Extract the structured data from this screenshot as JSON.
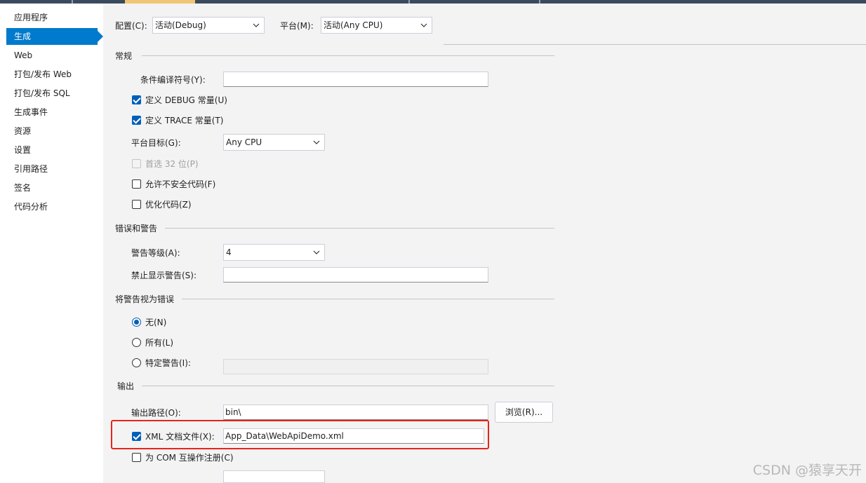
{
  "sidebar": {
    "items": [
      {
        "label": "应用程序",
        "active": false
      },
      {
        "label": "生成",
        "active": true
      },
      {
        "label": "Web",
        "active": false
      },
      {
        "label": "打包/发布 Web",
        "active": false
      },
      {
        "label": "打包/发布 SQL",
        "active": false
      },
      {
        "label": "生成事件",
        "active": false
      },
      {
        "label": "资源",
        "active": false
      },
      {
        "label": "设置",
        "active": false
      },
      {
        "label": "引用路径",
        "active": false
      },
      {
        "label": "签名",
        "active": false
      },
      {
        "label": "代码分析",
        "active": false
      }
    ]
  },
  "header": {
    "config_label": "配置(C):",
    "config_value": "活动(Debug)",
    "platform_label": "平台(M):",
    "platform_value": "活动(Any CPU)"
  },
  "general": {
    "title": "常规",
    "conditional_symbols_label": "条件编译符号(Y):",
    "conditional_symbols_value": "",
    "define_debug_label": "定义 DEBUG 常量(U)",
    "define_debug_checked": true,
    "define_trace_label": "定义 TRACE 常量(T)",
    "define_trace_checked": true,
    "platform_target_label": "平台目标(G):",
    "platform_target_value": "Any CPU",
    "prefer32_label": "首选 32 位(P)",
    "prefer32_checked": false,
    "allow_unsafe_label": "允许不安全代码(F)",
    "allow_unsafe_checked": false,
    "optimize_label": "优化代码(Z)",
    "optimize_checked": false
  },
  "errors": {
    "title": "错误和警告",
    "warning_level_label": "警告等级(A):",
    "warning_level_value": "4",
    "suppress_warnings_label": "禁止显示警告(S):",
    "suppress_warnings_value": ""
  },
  "treat_warnings": {
    "title": "将警告视为错误",
    "none_label": "无(N)",
    "all_label": "所有(L)",
    "specific_label": "特定警告(I):",
    "selected": "none",
    "specific_value": ""
  },
  "output": {
    "title": "输出",
    "output_path_label": "输出路径(O):",
    "output_path_value": "bin\\",
    "browse_label": "浏览(R)...",
    "xml_doc_label": "XML 文档文件(X):",
    "xml_doc_checked": true,
    "xml_doc_value": "App_Data\\WebApiDemo.xml",
    "com_interop_label": "为 COM 互操作注册(C)",
    "com_interop_checked": false
  },
  "watermark": "CSDN @猿享天开",
  "colors": {
    "accent": "#007acc",
    "checkbox_blue": "#005fb8",
    "highlight_red": "#e8221c"
  }
}
